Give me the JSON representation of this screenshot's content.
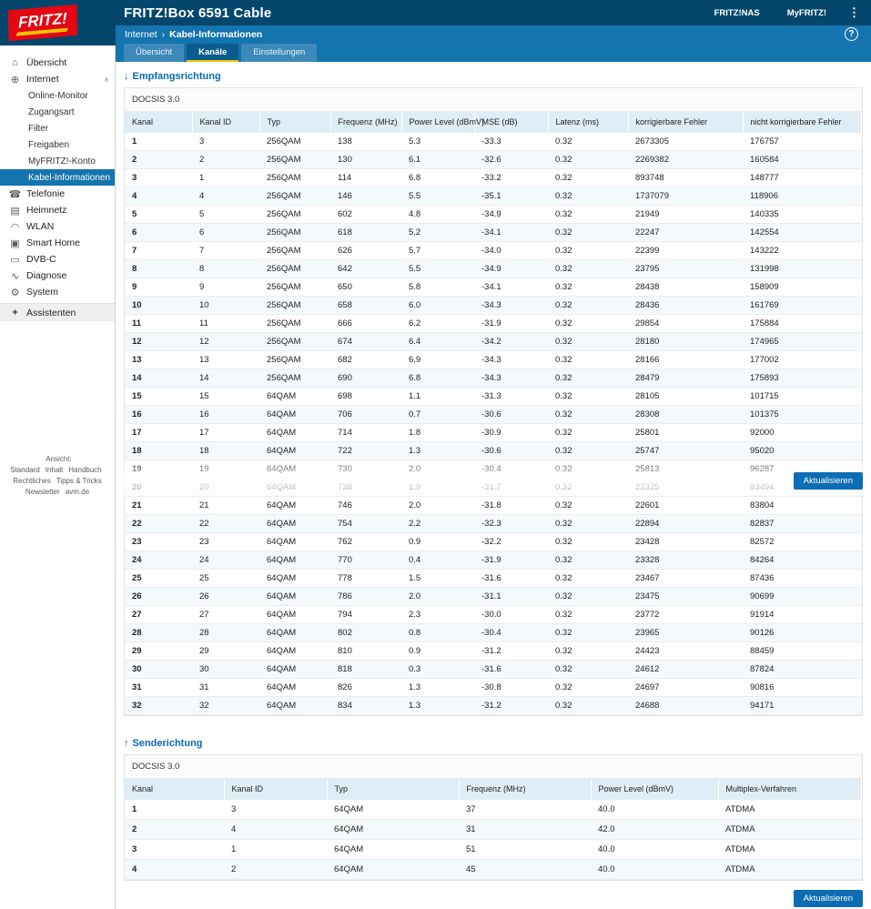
{
  "colors": {
    "header_bg": "#05476c",
    "band_bg": "#1474ae",
    "accent_yellow": "#fdc300",
    "brand_red": "#e30613",
    "button_blue": "#0d6db4",
    "table_header_bg": "#dfedf7"
  },
  "icons": {
    "help": "?",
    "menu": "⋮"
  },
  "header": {
    "brand": "FRITZ!",
    "title": "FRITZ!Box 6591 Cable",
    "nav_links": [
      "FRITZ!NAS",
      "MyFRITZ!"
    ]
  },
  "breadcrumb": {
    "items": [
      "Internet",
      "Kabel-Informationen"
    ],
    "separator": "›"
  },
  "tabs": [
    {
      "label": "Übersicht",
      "active": false
    },
    {
      "label": "Kanäle",
      "active": true
    },
    {
      "label": "Einstellungen",
      "active": false
    }
  ],
  "sidebar": {
    "items": [
      {
        "label": "Übersicht",
        "icon": "overview-icon",
        "type": "top"
      },
      {
        "label": "Internet",
        "icon": "internet-icon",
        "type": "top",
        "expanded": true
      },
      {
        "label": "Online-Monitor",
        "type": "sub"
      },
      {
        "label": "Zugangsart",
        "type": "sub"
      },
      {
        "label": "Filter",
        "type": "sub"
      },
      {
        "label": "Freigaben",
        "type": "sub"
      },
      {
        "label": "MyFRITZ!-Konto",
        "type": "sub"
      },
      {
        "label": "Kabel-Informationen",
        "type": "sub",
        "active": true
      },
      {
        "label": "Telefonie",
        "icon": "phone-icon",
        "type": "top"
      },
      {
        "label": "Heimnetz",
        "icon": "homenet-icon",
        "type": "top"
      },
      {
        "label": "WLAN",
        "icon": "wifi-icon",
        "type": "top"
      },
      {
        "label": "Smart Home",
        "icon": "smarthome-icon",
        "type": "top"
      },
      {
        "label": "DVB-C",
        "icon": "tv-icon",
        "type": "top"
      },
      {
        "label": "Diagnose",
        "icon": "diagnose-icon",
        "type": "top"
      },
      {
        "label": "System",
        "icon": "gear-icon",
        "type": "top"
      },
      {
        "label": "Assistenten",
        "icon": "assistant-icon",
        "type": "top",
        "section": true
      }
    ],
    "footer_links": [
      [
        "Ansicht: Standard",
        "Inhalt",
        "Handbuch"
      ],
      [
        "Rechtliches",
        "Tipps & Tricks"
      ],
      [
        "Newsletter",
        "avm.de"
      ]
    ]
  },
  "downstream": {
    "arrow": "↓",
    "title": "Empfangsrichtung",
    "subtitle": "DOCSIS 3.0",
    "columns": [
      "Kanal",
      "Kanal ID",
      "Typ",
      "Frequenz (MHz)",
      "Power Level (dBmV)",
      "MSE (dB)",
      "Latenz (ms)",
      "korrigierbare Fehler",
      "nicht korrigierbare Fehler"
    ],
    "rows": [
      [
        "1",
        "3",
        "256QAM",
        "138",
        "5.3",
        "-33.3",
        "0.32",
        "2673305",
        "176757"
      ],
      [
        "2",
        "2",
        "256QAM",
        "130",
        "6.1",
        "-32.6",
        "0.32",
        "2269382",
        "160584"
      ],
      [
        "3",
        "1",
        "256QAM",
        "114",
        "6.8",
        "-33.2",
        "0.32",
        "893748",
        "148777"
      ],
      [
        "4",
        "4",
        "256QAM",
        "146",
        "5.5",
        "-35.1",
        "0.32",
        "1737079",
        "118906"
      ],
      [
        "5",
        "5",
        "256QAM",
        "602",
        "4.8",
        "-34.9",
        "0.32",
        "21949",
        "140335"
      ],
      [
        "6",
        "6",
        "256QAM",
        "618",
        "5.2",
        "-34.1",
        "0.32",
        "22247",
        "142554"
      ],
      [
        "7",
        "7",
        "256QAM",
        "626",
        "5.7",
        "-34.0",
        "0.32",
        "22399",
        "143222"
      ],
      [
        "8",
        "8",
        "256QAM",
        "642",
        "5.5",
        "-34.9",
        "0.32",
        "23795",
        "131998"
      ],
      [
        "9",
        "9",
        "256QAM",
        "650",
        "5.8",
        "-34.1",
        "0.32",
        "28438",
        "158909"
      ],
      [
        "10",
        "10",
        "256QAM",
        "658",
        "6.0",
        "-34.3",
        "0.32",
        "28436",
        "161769"
      ],
      [
        "11",
        "11",
        "256QAM",
        "666",
        "6.2",
        "-31.9",
        "0.32",
        "29854",
        "175884"
      ],
      [
        "12",
        "12",
        "256QAM",
        "674",
        "6.4",
        "-34.2",
        "0.32",
        "28180",
        "174965"
      ],
      [
        "13",
        "13",
        "256QAM",
        "682",
        "6.9",
        "-34.3",
        "0.32",
        "28166",
        "177002"
      ],
      [
        "14",
        "14",
        "256QAM",
        "690",
        "6.8",
        "-34.3",
        "0.32",
        "28479",
        "175893"
      ],
      [
        "15",
        "15",
        "64QAM",
        "698",
        "1.1",
        "-31.3",
        "0.32",
        "28105",
        "101715"
      ],
      [
        "16",
        "16",
        "64QAM",
        "706",
        "0.7",
        "-30.6",
        "0.32",
        "28308",
        "101375"
      ],
      [
        "17",
        "17",
        "64QAM",
        "714",
        "1.8",
        "-30.9",
        "0.32",
        "25801",
        "92000"
      ],
      [
        "18",
        "18",
        "64QAM",
        "722",
        "1.3",
        "-30.6",
        "0.32",
        "25747",
        "95020"
      ],
      [
        "19",
        "19",
        "64QAM",
        "730",
        "2.0",
        "-30.4",
        "0.32",
        "25813",
        "96287"
      ],
      [
        "20",
        "20",
        "64QAM",
        "738",
        "1.9",
        "-31.7",
        "0.32",
        "22325",
        "83494"
      ],
      [
        "21",
        "21",
        "64QAM",
        "746",
        "2.0",
        "-31.8",
        "0.32",
        "22601",
        "83804"
      ],
      [
        "22",
        "22",
        "64QAM",
        "754",
        "2.2",
        "-32.3",
        "0.32",
        "22894",
        "82837"
      ],
      [
        "23",
        "23",
        "64QAM",
        "762",
        "0.9",
        "-32.2",
        "0.32",
        "23428",
        "82572"
      ],
      [
        "24",
        "24",
        "64QAM",
        "770",
        "0.4",
        "-31.9",
        "0.32",
        "23328",
        "84264"
      ],
      [
        "25",
        "25",
        "64QAM",
        "778",
        "1.5",
        "-31.6",
        "0.32",
        "23467",
        "87436"
      ],
      [
        "26",
        "26",
        "64QAM",
        "786",
        "2.0",
        "-31.1",
        "0.32",
        "23475",
        "90699"
      ],
      [
        "27",
        "27",
        "64QAM",
        "794",
        "2.3",
        "-30.0",
        "0.32",
        "23772",
        "91914"
      ],
      [
        "28",
        "28",
        "64QAM",
        "802",
        "0.8",
        "-30.4",
        "0.32",
        "23965",
        "90126"
      ],
      [
        "29",
        "29",
        "64QAM",
        "810",
        "0.9",
        "-31.2",
        "0.32",
        "24423",
        "88459"
      ],
      [
        "30",
        "30",
        "64QAM",
        "818",
        "0.3",
        "-31.6",
        "0.32",
        "24612",
        "87824"
      ],
      [
        "31",
        "31",
        "64QAM",
        "826",
        "1.3",
        "-30.8",
        "0.32",
        "24697",
        "90816"
      ],
      [
        "32",
        "32",
        "64QAM",
        "834",
        "1.3",
        "-31.2",
        "0.32",
        "24688",
        "94171"
      ]
    ]
  },
  "upstream": {
    "arrow": "↑",
    "title": "Senderichtung",
    "subtitle": "DOCSIS 3.0",
    "columns": [
      "Kanal",
      "Kanal ID",
      "Typ",
      "Frequenz (MHz)",
      "Power Level (dBmV)",
      "Multiplex-Verfahren"
    ],
    "rows": [
      [
        "1",
        "3",
        "64QAM",
        "37",
        "40.0",
        "ATDMA"
      ],
      [
        "2",
        "4",
        "64QAM",
        "31",
        "42.0",
        "ATDMA"
      ],
      [
        "3",
        "1",
        "64QAM",
        "51",
        "40.0",
        "ATDMA"
      ],
      [
        "4",
        "2",
        "64QAM",
        "45",
        "40.0",
        "ATDMA"
      ]
    ]
  },
  "buttons": {
    "refresh": "Aktualisieren"
  }
}
